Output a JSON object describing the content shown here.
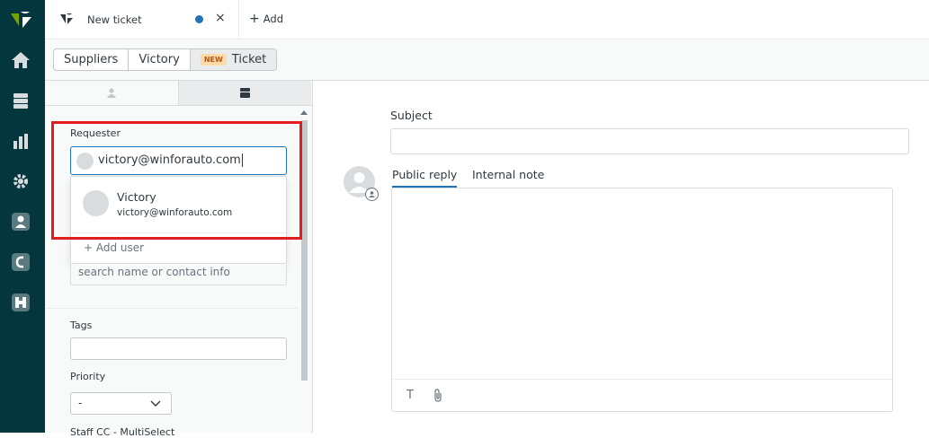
{
  "tabs": {
    "active_tab_title": "New ticket",
    "add_label": "Add"
  },
  "breadcrumbs": [
    "Suppliers",
    "Victory"
  ],
  "ticket_badge": "NEW",
  "ticket_crumb": "Ticket",
  "requester": {
    "label": "Requester",
    "value": "victory@winforauto.com",
    "suggestion_name": "Victory",
    "suggestion_email": "victory@winforauto.com",
    "add_user": "+ Add user",
    "search_placeholder": "search name or contact info"
  },
  "tags_label": "Tags",
  "priority": {
    "label": "Priority",
    "value": "-"
  },
  "staff_cc_label": "Staff CC - MultiSelect",
  "subject_label": "Subject",
  "reply_tabs": {
    "public": "Public reply",
    "internal": "Internal note"
  },
  "editor_tools": {
    "text": "T"
  },
  "colors": {
    "nav_bg": "#03363d",
    "accent": "#1f73b7",
    "highlight": "#e01e1e",
    "new_badge_bg": "#fcdba9"
  }
}
